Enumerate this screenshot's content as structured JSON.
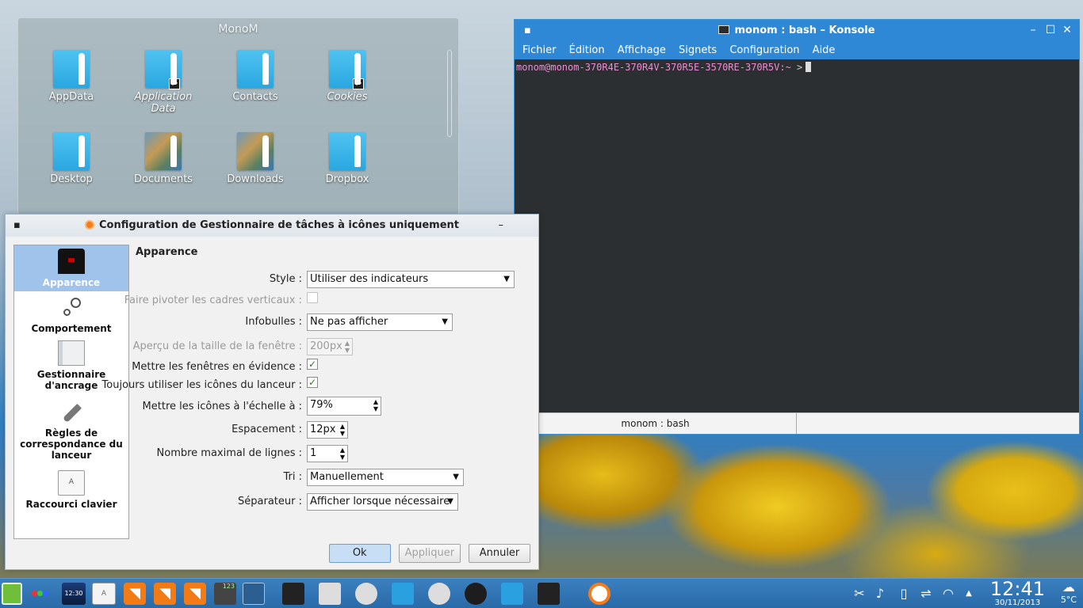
{
  "folderview": {
    "title": "MonoM",
    "items": [
      {
        "label": "AppData",
        "link": false,
        "photo": false
      },
      {
        "label": "Application Data",
        "link": true,
        "photo": false
      },
      {
        "label": "Contacts",
        "link": false,
        "photo": false
      },
      {
        "label": "Cookies",
        "link": true,
        "photo": false
      },
      {
        "label": "Desktop",
        "link": false,
        "photo": false
      },
      {
        "label": "Documents",
        "link": false,
        "photo": true
      },
      {
        "label": "Downloads",
        "link": false,
        "photo": true
      },
      {
        "label": "Dropbox",
        "link": false,
        "photo": false
      }
    ]
  },
  "konsole": {
    "title": "monom : bash – Konsole",
    "menu": [
      "Fichier",
      "Édition",
      "Affichage",
      "Signets",
      "Configuration",
      "Aide"
    ],
    "prompt_user": "monom@monom-370R4E-370R4V-370R5E-3570RE-370R5V",
    "prompt_path": ":~",
    "prompt_symbol": ">",
    "tab_label": "monom : bash",
    "prompt_color": "#e98fd3",
    "titlebar_color": "#2e88d6"
  },
  "dialog": {
    "title": "Configuration de Gestionnaire de tâches à icônes uniquement",
    "pages": [
      {
        "label": "Apparence",
        "icon": "tuxedo-icon",
        "active": true
      },
      {
        "label": "Comportement",
        "icon": "gears-icon",
        "active": false
      },
      {
        "label": "Gestionnaire d'ancrage",
        "icon": "dock-icon",
        "active": false
      },
      {
        "label": "Règles de correspondance du lanceur",
        "icon": "rocket-icon",
        "active": false
      },
      {
        "label": "Raccourci clavier",
        "icon": "keyboard-key-icon",
        "active": false
      }
    ],
    "heading": "Apparence",
    "fields": {
      "style": {
        "label": "Style :",
        "value": "Utiliser des indicateurs"
      },
      "rotate": {
        "label": "Faire pivoter les cadres verticaux :",
        "checked": false,
        "disabled": true
      },
      "tooltips": {
        "label": "Infobulles :",
        "value": "Ne pas afficher"
      },
      "preview_size": {
        "label": "Aperçu de la taille de la fenêtre :",
        "value": "200px",
        "disabled": true
      },
      "highlight": {
        "label": "Mettre les fenêtres en évidence :",
        "checked": true
      },
      "launcher_icons": {
        "label": "Toujours utiliser les icônes du lanceur :",
        "checked": true
      },
      "scale": {
        "label": "Mettre les icônes à l'échelle à :",
        "value": "79%"
      },
      "spacing": {
        "label": "Espacement :",
        "value": "12px"
      },
      "max_rows": {
        "label": "Nombre maximal de lignes :",
        "value": "1"
      },
      "sort": {
        "label": "Tri :",
        "value": "Manuellement"
      },
      "separator": {
        "label": "Séparateur :",
        "value": "Afficher lorsque nécessaire"
      }
    },
    "buttons": {
      "ok": "Ok",
      "apply": "Appliquer",
      "cancel": "Annuler"
    }
  },
  "taskbar": {
    "clockapp_label": "12:30",
    "key_label": "A",
    "calc_label": "123",
    "clock_time": "12:41",
    "clock_date": "30/11/2013",
    "weather_temp": "5°C"
  }
}
